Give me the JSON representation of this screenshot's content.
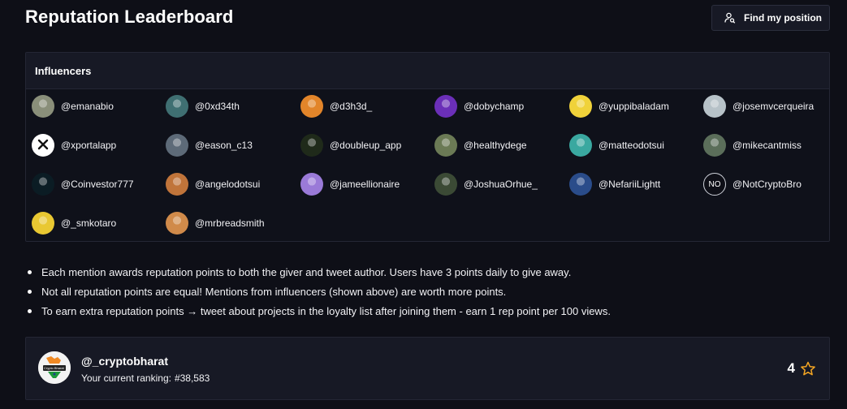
{
  "page": {
    "title": "Reputation Leaderboard"
  },
  "find_button": {
    "label": "Find my position",
    "icon": "user-search-icon"
  },
  "influencers": {
    "heading": "Influencers",
    "items": [
      {
        "handle": "@emanabio",
        "color": "#8a8f7a"
      },
      {
        "handle": "@0xd34th",
        "color": "#3f6f72"
      },
      {
        "handle": "@d3h3d_",
        "color": "#e2852a"
      },
      {
        "handle": "@dobychamp",
        "color": "#6b2fb8"
      },
      {
        "handle": "@yuppibaladam",
        "color": "#f0d23a"
      },
      {
        "handle": "@josemvcerqueira",
        "color": "#b7c2c8"
      },
      {
        "handle": "@xportalapp",
        "color": "#ffffff"
      },
      {
        "handle": "@eason_c13",
        "color": "#5d6a78"
      },
      {
        "handle": "@doubleup_app",
        "color": "#1f2a1a"
      },
      {
        "handle": "@healthydege",
        "color": "#6b7a55"
      },
      {
        "handle": "@matteodotsui",
        "color": "#3aa8a0"
      },
      {
        "handle": "@mikecantmiss",
        "color": "#5b6e5a"
      },
      {
        "handle": "@Coinvestor777",
        "color": "#0b1c24"
      },
      {
        "handle": "@angelodotsui",
        "color": "#c0743a"
      },
      {
        "handle": "@jameellionaire",
        "color": "#9a7ad8"
      },
      {
        "handle": "@JoshuaOrhue_",
        "color": "#3b4a35"
      },
      {
        "handle": "@NefariiLightt",
        "color": "#2a4c8a"
      },
      {
        "handle": "@NotCryptoBro",
        "color": "#0e0f17",
        "avatar_text": "NO"
      },
      {
        "handle": "@_smkotaro",
        "color": "#e9c832"
      },
      {
        "handle": "@mrbreadsmith",
        "color": "#d08a4a"
      }
    ]
  },
  "info": {
    "bullets": [
      "Each mention awards reputation points to both the giver and tweet author. Users have 3 points daily to give away.",
      "Not all reputation points are equal! Mentions from influencers (shown above) are worth more points.",
      "To earn extra reputation points → tweet about projects in the loyalty list after joining them - earn 1 rep point per 100 views."
    ]
  },
  "user": {
    "handle": "@_cryptobharat",
    "ranking_label": "Your current ranking:",
    "ranking_value": "#38,583",
    "points": "4",
    "points_icon": "star-icon",
    "avatar_text": "Crypto Bharat"
  },
  "colors": {
    "background": "#0e0f17",
    "panel": "#171925",
    "border": "#242634",
    "star": "#f5a623"
  }
}
